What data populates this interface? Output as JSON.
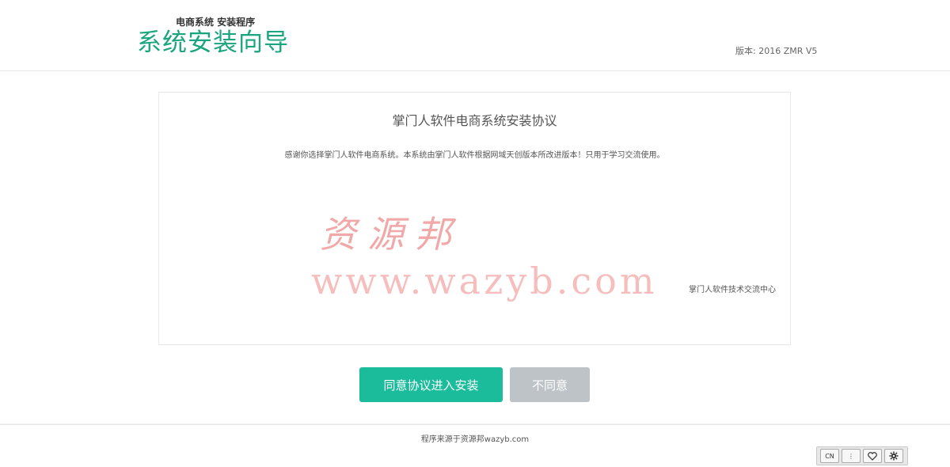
{
  "header": {
    "subtitle": "电商系统 安装程序",
    "title": "系统安装向导",
    "version": "版本: 2016 ZMR V5"
  },
  "agreement": {
    "title": "掌门人软件电商系统安装协议",
    "body": "感谢你选择掌门人软件电商系统。本系统由掌门人软件根据网域天创版本所改进版本！只用于学习交流使用。",
    "signature": "掌门人软件技术交流中心"
  },
  "watermark": {
    "line1": "资源邦",
    "line2": "www.wazyb.com"
  },
  "buttons": {
    "agree": "同意协议进入安装",
    "disagree": "不同意"
  },
  "footer": {
    "text": "程序来源于资源邦wazyb.com"
  },
  "toolbar": {
    "lang_label": "CN",
    "more_label": "⋮",
    "icons": [
      "lang-icon",
      "more-icon",
      "heart-icon",
      "gear-icon"
    ]
  },
  "colors": {
    "accent": "#1abc9c",
    "title_green": "#1aa57f",
    "disabled": "#bdc3c7",
    "watermark": "#ef9a9a"
  }
}
